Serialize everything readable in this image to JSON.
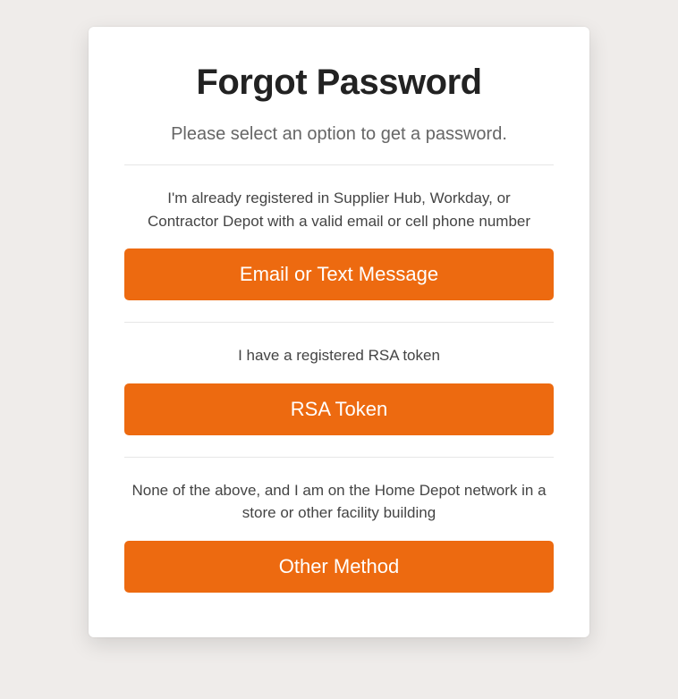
{
  "title": "Forgot Password",
  "subtitle": "Please select an option to get a password.",
  "options": [
    {
      "description": "I'm already registered in Supplier Hub, Workday, or Contractor Depot with a valid email or cell phone number",
      "button_label": "Email or Text Message"
    },
    {
      "description": "I have a registered RSA token",
      "button_label": "RSA Token"
    },
    {
      "description": "None of the above, and I am on the Home Depot network in a store or other facility building",
      "button_label": "Other Method"
    }
  ]
}
